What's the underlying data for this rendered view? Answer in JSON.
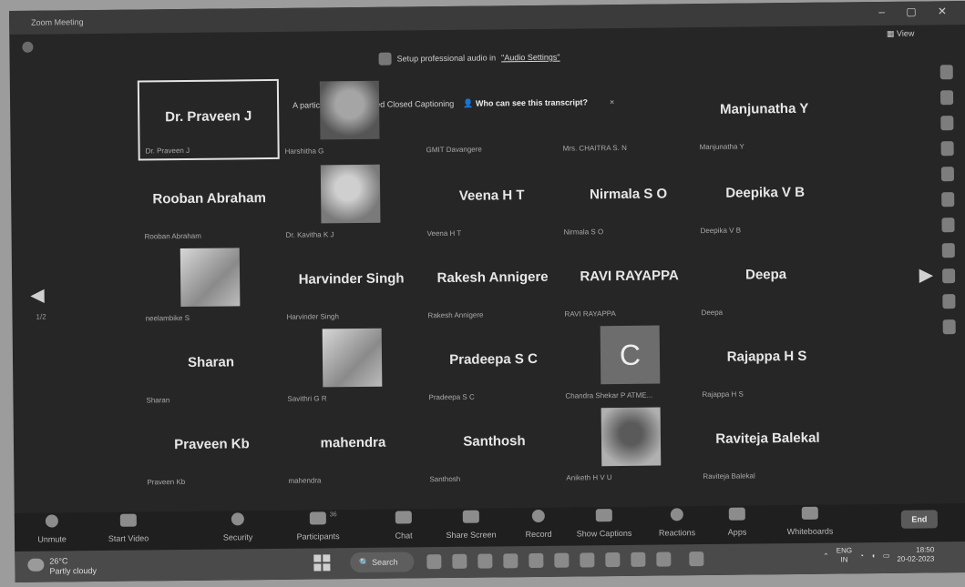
{
  "window": {
    "title": "Zoom Meeting",
    "view_label": "View"
  },
  "banners": {
    "audio_text": "Setup professional audio in",
    "audio_link": "\"Audio Settings\"",
    "cc_text": "A participant has enabled Closed Captioning",
    "cc_question": "Who can see this transcript?",
    "cc_close": "×"
  },
  "participants": [
    {
      "display": "Dr. Praveen J",
      "label": "Dr. Praveen J",
      "active": true
    },
    {
      "display": "",
      "label": "Harshitha G",
      "photo": "p1"
    },
    {
      "display": "",
      "label": "GMIT Davangere"
    },
    {
      "display": "",
      "label": "Mrs. CHAITRA S. N"
    },
    {
      "display": "Manjunatha Y",
      "label": "Manjunatha Y"
    },
    {
      "display": "Rooban Abraham",
      "label": "Rooban Abraham"
    },
    {
      "display": "",
      "label": "Dr. Kavitha K J",
      "photo": "p2"
    },
    {
      "display": "Veena H T",
      "label": "Veena H T"
    },
    {
      "display": "Nirmala S O",
      "label": "Nirmala S O"
    },
    {
      "display": "Deepika V B",
      "label": "Deepika V B"
    },
    {
      "display": "",
      "label": "neelambike S",
      "photo": "p3"
    },
    {
      "display": "Harvinder Singh",
      "label": "Harvinder Singh"
    },
    {
      "display": "Rakesh Annigere",
      "label": "Rakesh Annigere"
    },
    {
      "display": "RAVI RAYAPPA",
      "label": "RAVI RAYAPPA"
    },
    {
      "display": "Deepa",
      "label": "Deepa"
    },
    {
      "display": "Sharan",
      "label": "Sharan"
    },
    {
      "display": "",
      "label": "Savithri G R",
      "photo": "p3"
    },
    {
      "display": "Pradeepa S C",
      "label": "Pradeepa S C"
    },
    {
      "display": "",
      "label": "Chandra Shekar P ATME...",
      "photo": "c",
      "initial": "C"
    },
    {
      "display": "Rajappa H S",
      "label": "Rajappa H S"
    },
    {
      "display": "Praveen Kb",
      "label": "Praveen Kb"
    },
    {
      "display": "mahendra",
      "label": "mahendra"
    },
    {
      "display": "Santhosh",
      "label": "Santhosh"
    },
    {
      "display": "",
      "label": "Aniketh H V U",
      "photo": "p4"
    },
    {
      "display": "Raviteja Balekal",
      "label": "Raviteja Balekal"
    }
  ],
  "page_indicator": "1/2",
  "toolbar": {
    "unmute": "Unmute",
    "start_video": "Start Video",
    "security": "Security",
    "participants": "Participants",
    "participants_count": "36",
    "chat": "Chat",
    "share_screen": "Share Screen",
    "record": "Record",
    "show_captions": "Show Captions",
    "reactions": "Reactions",
    "apps": "Apps",
    "whiteboards": "Whiteboards",
    "end": "End"
  },
  "taskbar": {
    "temperature": "26°C",
    "weather": "Partly cloudy",
    "search": "Search",
    "lang_1": "ENG",
    "lang_2": "IN",
    "time": "18:50",
    "date": "20-02-2023"
  }
}
